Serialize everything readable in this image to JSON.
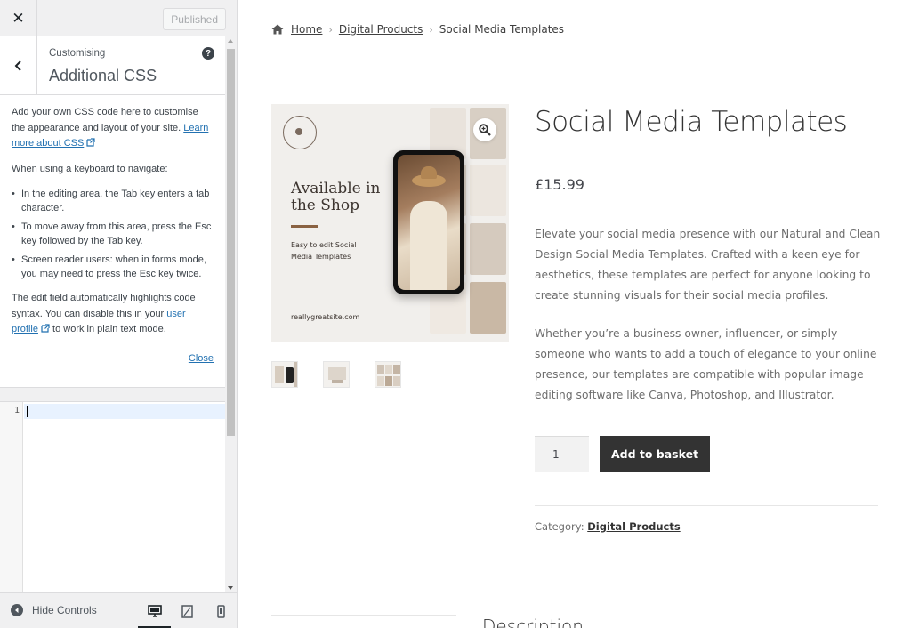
{
  "customizer": {
    "close_label": "✕",
    "publish_label": "Published",
    "section_kicker": "Customising",
    "section_title": "Additional CSS",
    "help_label": "?",
    "intro_text": "Add your own CSS code here to customise the appearance and layout of your site.",
    "learn_more_link": "Learn more about CSS",
    "keyboard_intro": "When using a keyboard to navigate:",
    "keyboard_tips": [
      "In the editing area, the Tab key enters a tab character.",
      "To move away from this area, press the Esc key followed by the Tab key.",
      "Screen reader users: when in forms mode, you may need to press the Esc key twice."
    ],
    "highlight_text_before": "The edit field automatically highlights code syntax. You can disable this in your",
    "user_profile_link": "user profile",
    "highlight_text_after": "to work in plain text mode.",
    "close_link": "Close",
    "editor_line_number": "1",
    "hide_controls_label": "Hide Controls"
  },
  "breadcrumb": {
    "home": "Home",
    "category": "Digital Products",
    "current": "Social Media Templates"
  },
  "gallery": {
    "headline": "Available in the Shop",
    "subline": "Easy to edit Social Media Templates",
    "site": "reallygreatsite.com"
  },
  "product": {
    "title": "Social Media Templates",
    "price": "£15.99",
    "description_1": "Elevate your social media presence with our Natural and Clean Design Social Media Templates. Crafted with a keen eye for aesthetics, these templates are perfect for anyone looking to create stunning visuals for their social media profiles.",
    "description_2": "Whether you’re a business owner, influencer, or simply someone who wants to add a touch of elegance to your online presence, our templates are compatible with popular image editing software like Canva, Photoshop, and Illustrator.",
    "quantity": "1",
    "add_to_basket_label": "Add to basket",
    "category_label": "Category:",
    "category_value": "Digital Products",
    "description_tab": "Description"
  },
  "colors": {
    "link": "#2271b1",
    "button_dark": "#333333",
    "sidebar_bg": "#f0f0f1"
  }
}
